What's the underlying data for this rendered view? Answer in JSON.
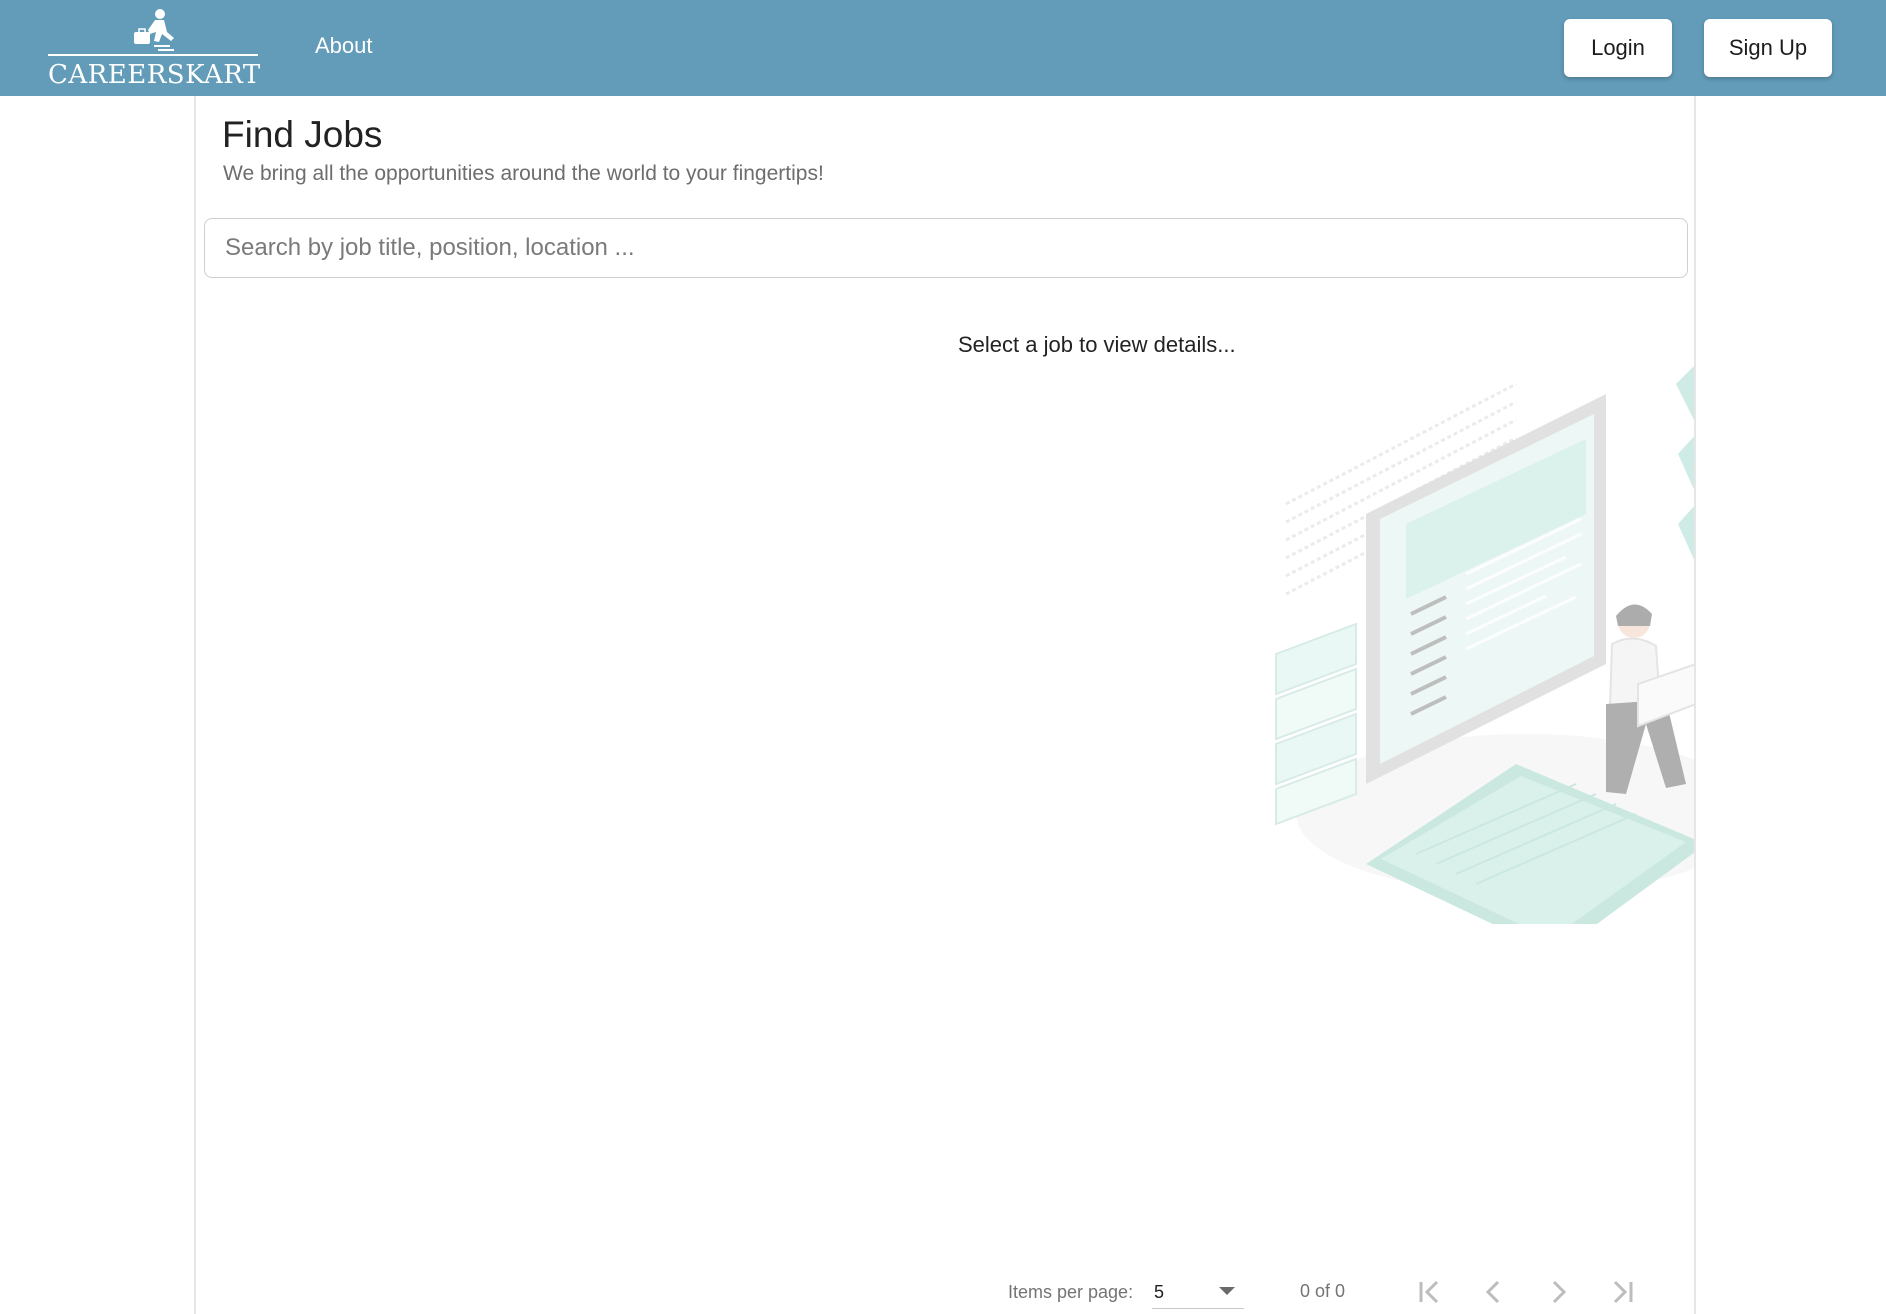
{
  "header": {
    "logo_text": "CAREERSKART",
    "nav": {
      "about": "About"
    },
    "login_label": "Login",
    "signup_label": "Sign Up"
  },
  "main": {
    "title": "Find Jobs",
    "subtitle": "We bring all the opportunities around the world to your fingertips!",
    "search": {
      "placeholder": "Search by job title, position, location ...",
      "value": ""
    },
    "empty_state": "Select a job to view details..."
  },
  "paginator": {
    "items_per_page_label": "Items per page:",
    "items_per_page_value": "5",
    "range_label": "0 of 0"
  },
  "colors": {
    "navbar": "#629cb9",
    "illustration_accent": "#a8dcd0"
  },
  "icons": [
    "person-briefcase-logo-icon",
    "dropdown-caret-icon",
    "first-page-icon",
    "previous-page-icon",
    "next-page-icon",
    "last-page-icon"
  ]
}
